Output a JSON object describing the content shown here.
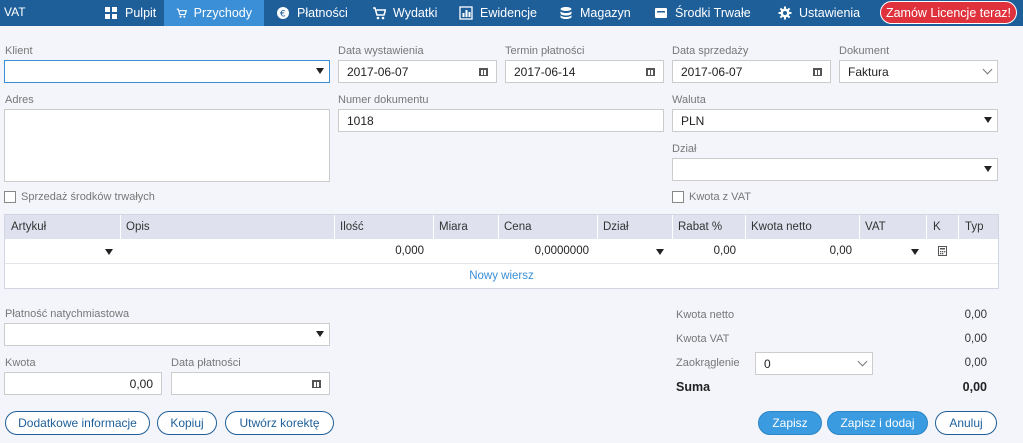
{
  "nav": {
    "brand": "VAT",
    "items": [
      {
        "label": "Pulpit",
        "icon": "dashboard-icon"
      },
      {
        "label": "Przychody",
        "icon": "cart-icon"
      },
      {
        "label": "Płatności",
        "icon": "euro-icon"
      },
      {
        "label": "Wydatki",
        "icon": "cart-icon"
      },
      {
        "label": "Ewidencje",
        "icon": "chart-icon"
      },
      {
        "label": "Magazyn",
        "icon": "database-icon"
      },
      {
        "label": "Środki Trwałe",
        "icon": "box-icon"
      },
      {
        "label": "Ustawienia",
        "icon": "gear-icon"
      }
    ],
    "order_button": "Zamów Licencje teraz!"
  },
  "form": {
    "klient_label": "Klient",
    "klient_value": "",
    "data_wystawienia_label": "Data wystawienia",
    "data_wystawienia_value": "2017-06-07",
    "termin_platnosci_label": "Termin płatności",
    "termin_platnosci_value": "2017-06-14",
    "data_sprzedazy_label": "Data sprzedaży",
    "data_sprzedazy_value": "2017-06-07",
    "dokument_label": "Dokument",
    "dokument_value": "Faktura",
    "adres_label": "Adres",
    "numer_dokumentu_label": "Numer dokumentu",
    "numer_dokumentu_value": "1018",
    "waluta_label": "Waluta",
    "waluta_value": "PLN",
    "dzial_label": "Dział",
    "dzial_value": "",
    "sprzedaz_label": "Sprzedaż środków trwałych",
    "kwota_vat_label": "Kwota z VAT"
  },
  "table": {
    "headers": [
      "Artykuł",
      "Opis",
      "Ilość",
      "Miara",
      "Cena",
      "Dział",
      "Rabat %",
      "Kwota netto",
      "VAT",
      "K",
      "Typ"
    ],
    "row": {
      "ilosc": "0,000",
      "cena": "0,0000000",
      "rabat": "0,00",
      "kwota_netto": "0,00"
    },
    "new_row": "Nowy wiersz"
  },
  "payment": {
    "natychmiastowa_label": "Płatność natychmiastowa",
    "kwota_label": "Kwota",
    "kwota_value": "0,00",
    "data_platnosci_label": "Data płatności"
  },
  "summary": {
    "netto_label": "Kwota netto",
    "netto_value": "0,00",
    "vat_label": "Kwota VAT",
    "vat_value": "0,00",
    "zaokraglenie_label": "Zaokrąglenie",
    "zaokraglenie_select": "0",
    "zaokraglenie_value": "0,00",
    "suma_label": "Suma",
    "suma_value": "0,00"
  },
  "buttons": {
    "dodatkowe": "Dodatkowe informacje",
    "kopiuj": "Kopiuj",
    "korekta": "Utwórz korektę",
    "zapisz": "Zapisz",
    "zapisz_dodaj": "Zapisz i dodaj",
    "anuluj": "Anuluj"
  }
}
